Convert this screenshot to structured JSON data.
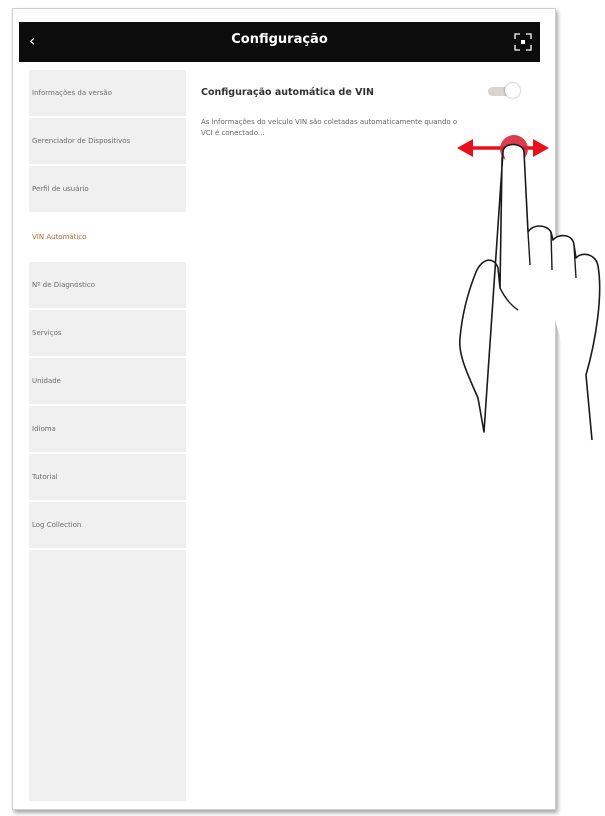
{
  "header": {
    "title": "Configuração",
    "back_icon": "chevron-left-icon",
    "fullscreen_icon": "fullscreen-icon"
  },
  "sidebar": {
    "items": [
      {
        "label": "Informações da versão",
        "active": false
      },
      {
        "label": "Gerenciador de Dispositivos",
        "active": false
      },
      {
        "label": "Perfil de usuário",
        "active": false
      },
      {
        "label": "VIN Automático",
        "active": true
      },
      {
        "label": "Nº de Diagnóstico",
        "active": false
      },
      {
        "label": "Serviços",
        "active": false
      },
      {
        "label": "Unidade",
        "active": false
      },
      {
        "label": "Idioma",
        "active": false
      },
      {
        "label": "Tutorial",
        "active": false
      },
      {
        "label": "Log Collection",
        "active": false
      }
    ]
  },
  "main": {
    "setting_title": "Configuração automática de VIN",
    "setting_description": "As informações do veículo VIN são coletadas automaticamente quando o VCI é conectado...",
    "toggle": {
      "state": "on"
    }
  },
  "overlay": {
    "gesture": "swipe-horizontal",
    "arrow_color": "#e8101a",
    "touch_color": "#d62839"
  },
  "colors": {
    "header_bg": "#0c0c0c",
    "sidebar_bg": "#f0f0f0",
    "active_item_text": "#b26a35"
  }
}
